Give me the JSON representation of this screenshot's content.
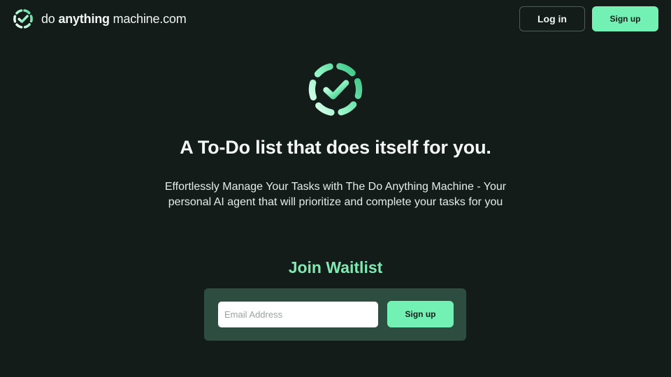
{
  "header": {
    "brand": {
      "part1": "do ",
      "part2": "anything",
      "part3": " machine.com",
      "logo_icon": "dashed-circle-check-icon"
    },
    "login_label": "Log in",
    "signup_label": "Sign up"
  },
  "hero": {
    "logo_icon": "dashed-circle-check-icon",
    "headline": "A To-Do list that does itself for you.",
    "subtitle": "Effortlessly Manage Your Tasks with The Do Anything Machine  - Your personal AI agent that will prioritize and complete your tasks for you"
  },
  "waitlist": {
    "title": "Join Waitlist",
    "email_value": "",
    "email_placeholder": "Email Address",
    "signup_label": "Sign up"
  },
  "colors": {
    "background": "#131c19",
    "accent": "#73f0b4",
    "panel": "#2e4d41",
    "title_green": "#7ee9b3"
  }
}
